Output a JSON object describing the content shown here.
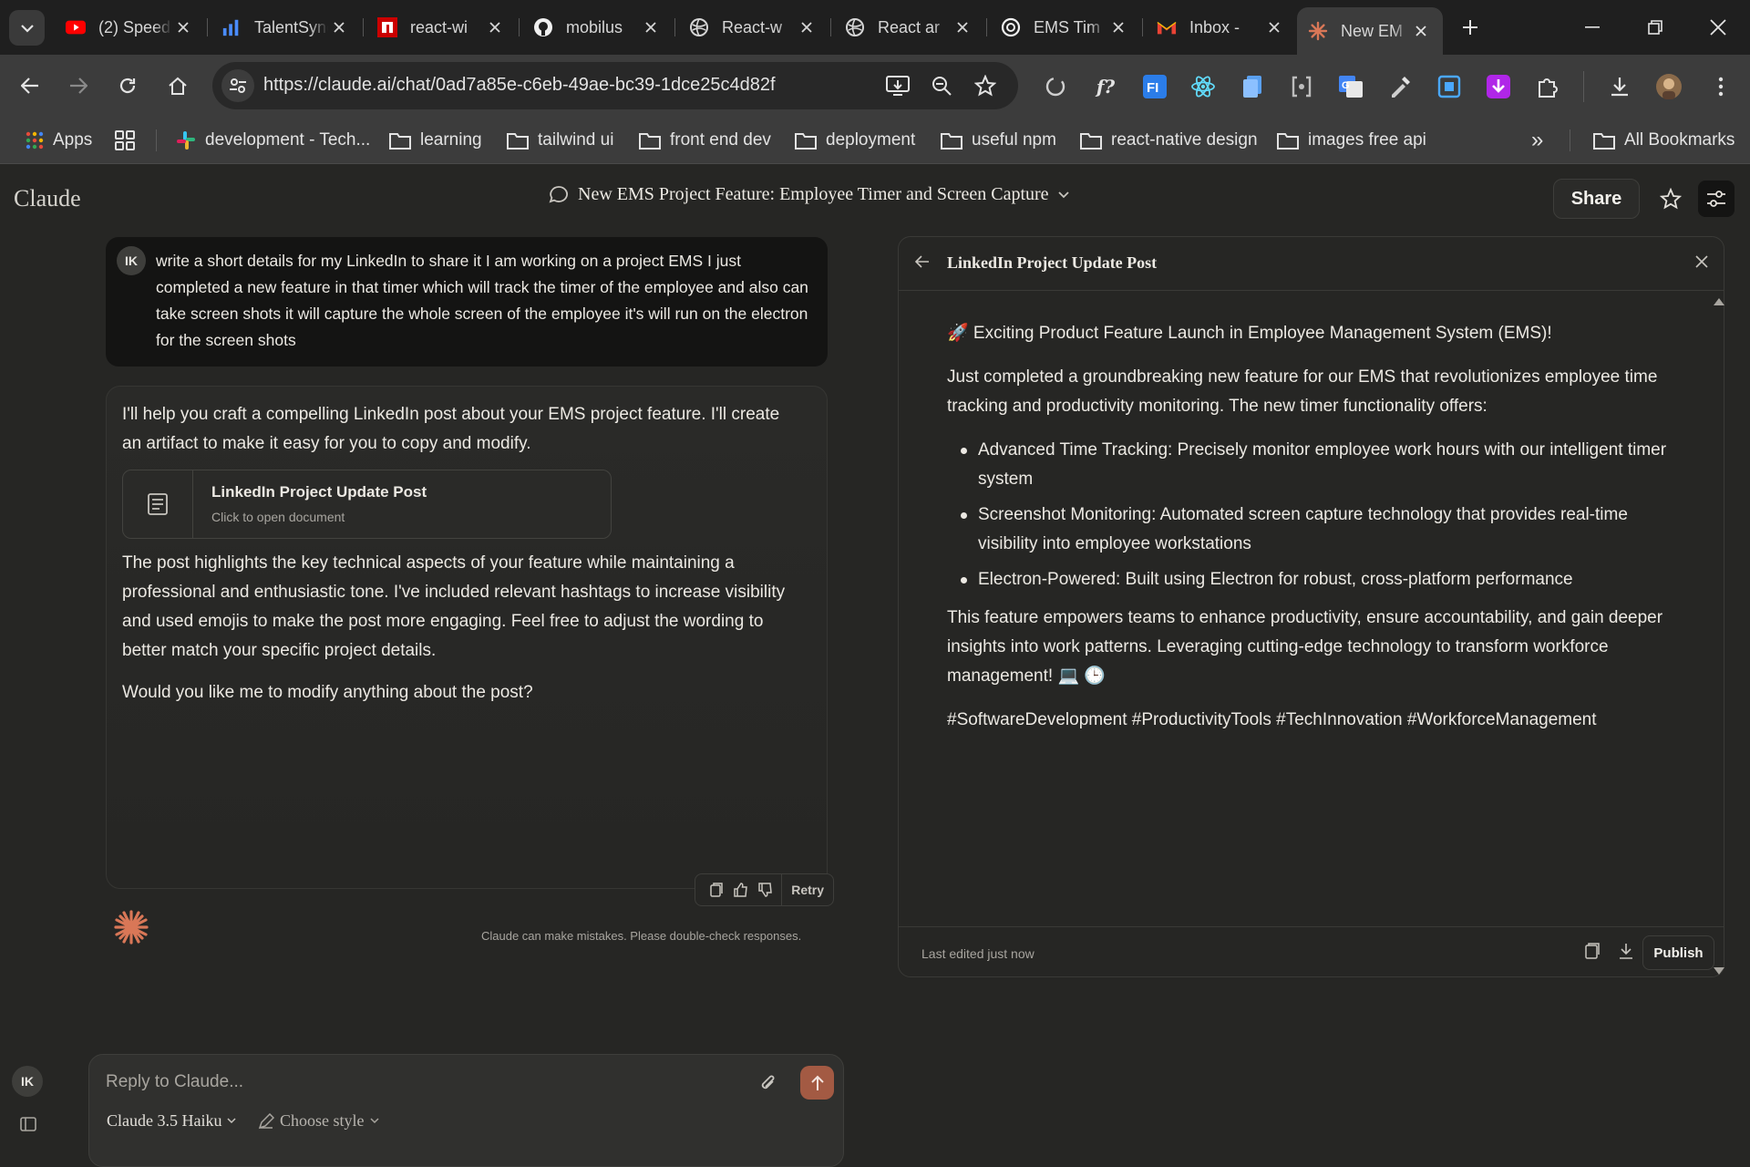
{
  "browser": {
    "tabs": [
      {
        "title": "(2) Speed",
        "icon": "youtube-icon"
      },
      {
        "title": "TalentSync",
        "icon": "talentsync-icon"
      },
      {
        "title": "react-wi",
        "icon": "npm-icon"
      },
      {
        "title": "mobilus",
        "icon": "github-icon"
      },
      {
        "title": "React-w",
        "icon": "globe-icon"
      },
      {
        "title": "React ar",
        "icon": "globe-icon"
      },
      {
        "title": "EMS Tim",
        "icon": "openai-icon"
      },
      {
        "title": "Inbox -",
        "icon": "gmail-icon"
      },
      {
        "title": "New EM",
        "icon": "claude-icon",
        "active": true
      }
    ],
    "url": "https://claude.ai/chat/0ad7a85e-c6eb-49ae-bc39-1dce25c4d82f",
    "bookmarks": [
      {
        "label": "Apps",
        "icon": "apps-grid-icon"
      },
      {
        "label": "",
        "icon": "tab-groups-icon"
      },
      {
        "label": "development - Tech...",
        "icon": "slack-icon"
      },
      {
        "label": "learning",
        "icon": "folder-icon"
      },
      {
        "label": "tailwind ui",
        "icon": "folder-icon"
      },
      {
        "label": "front end dev",
        "icon": "folder-icon"
      },
      {
        "label": "deployment",
        "icon": "folder-icon"
      },
      {
        "label": "useful npm",
        "icon": "folder-icon"
      },
      {
        "label": "react-native design",
        "icon": "folder-icon"
      },
      {
        "label": "images free api",
        "icon": "folder-icon"
      }
    ],
    "all_bookmarks": "All Bookmarks",
    "overflow": "»"
  },
  "app": {
    "logo": "Claude",
    "conversation_title": "New EMS Project Feature: Employee Timer and Screen Capture",
    "share_label": "Share",
    "user_initials": "IK",
    "user_message": "write a short details for my LinkedIn to share it I am working on a project EMS I just completed a new feature in that timer which will track the timer of the employee and also can take screen shots it will capture the whole screen of the employee it's will run on the electron for the screen shots",
    "assistant": {
      "intro": "I'll help you craft a compelling LinkedIn post about your EMS project feature. I'll create an artifact to make it easy for you to copy and modify.",
      "artifact_title": "LinkedIn Project Update Post",
      "artifact_subtitle": "Click to open document",
      "body": "The post highlights the key technical aspects of your feature while maintaining a professional and enthusiastic tone. I've included relevant hashtags to increase visibility and used emojis to make the post more engaging. Feel free to adjust the wording to better match your specific project details.",
      "question": "Would you like me to modify anything about the post?"
    },
    "retry_label": "Retry",
    "disclaimer": "Claude can make mistakes. Please double-check responses.",
    "composer": {
      "placeholder": "Reply to Claude...",
      "model": "Claude 3.5 Haiku",
      "style": "Choose style"
    }
  },
  "artifact_panel": {
    "title": "LinkedIn Project Update Post",
    "heading": "🚀 Exciting Product Feature Launch in Employee Management System (EMS)!",
    "intro": "Just completed a groundbreaking new feature for our EMS that revolutionizes employee time tracking and productivity monitoring. The new timer functionality offers:",
    "bullets": [
      "Advanced Time Tracking: Precisely monitor employee work hours with our intelligent timer system",
      "Screenshot Monitoring: Automated screen capture technology that provides real-time visibility into employee workstations",
      "Electron-Powered: Built using Electron for robust, cross-platform performance"
    ],
    "closing": "This feature empowers teams to enhance productivity, ensure accountability, and gain deeper insights into work patterns. Leveraging cutting-edge technology to transform workforce management! 💻 🕒",
    "hashtags": "#SoftwareDevelopment #ProductivityTools #TechInnovation #WorkforceManagement",
    "last_edited": "Last edited just now",
    "publish_label": "Publish"
  }
}
